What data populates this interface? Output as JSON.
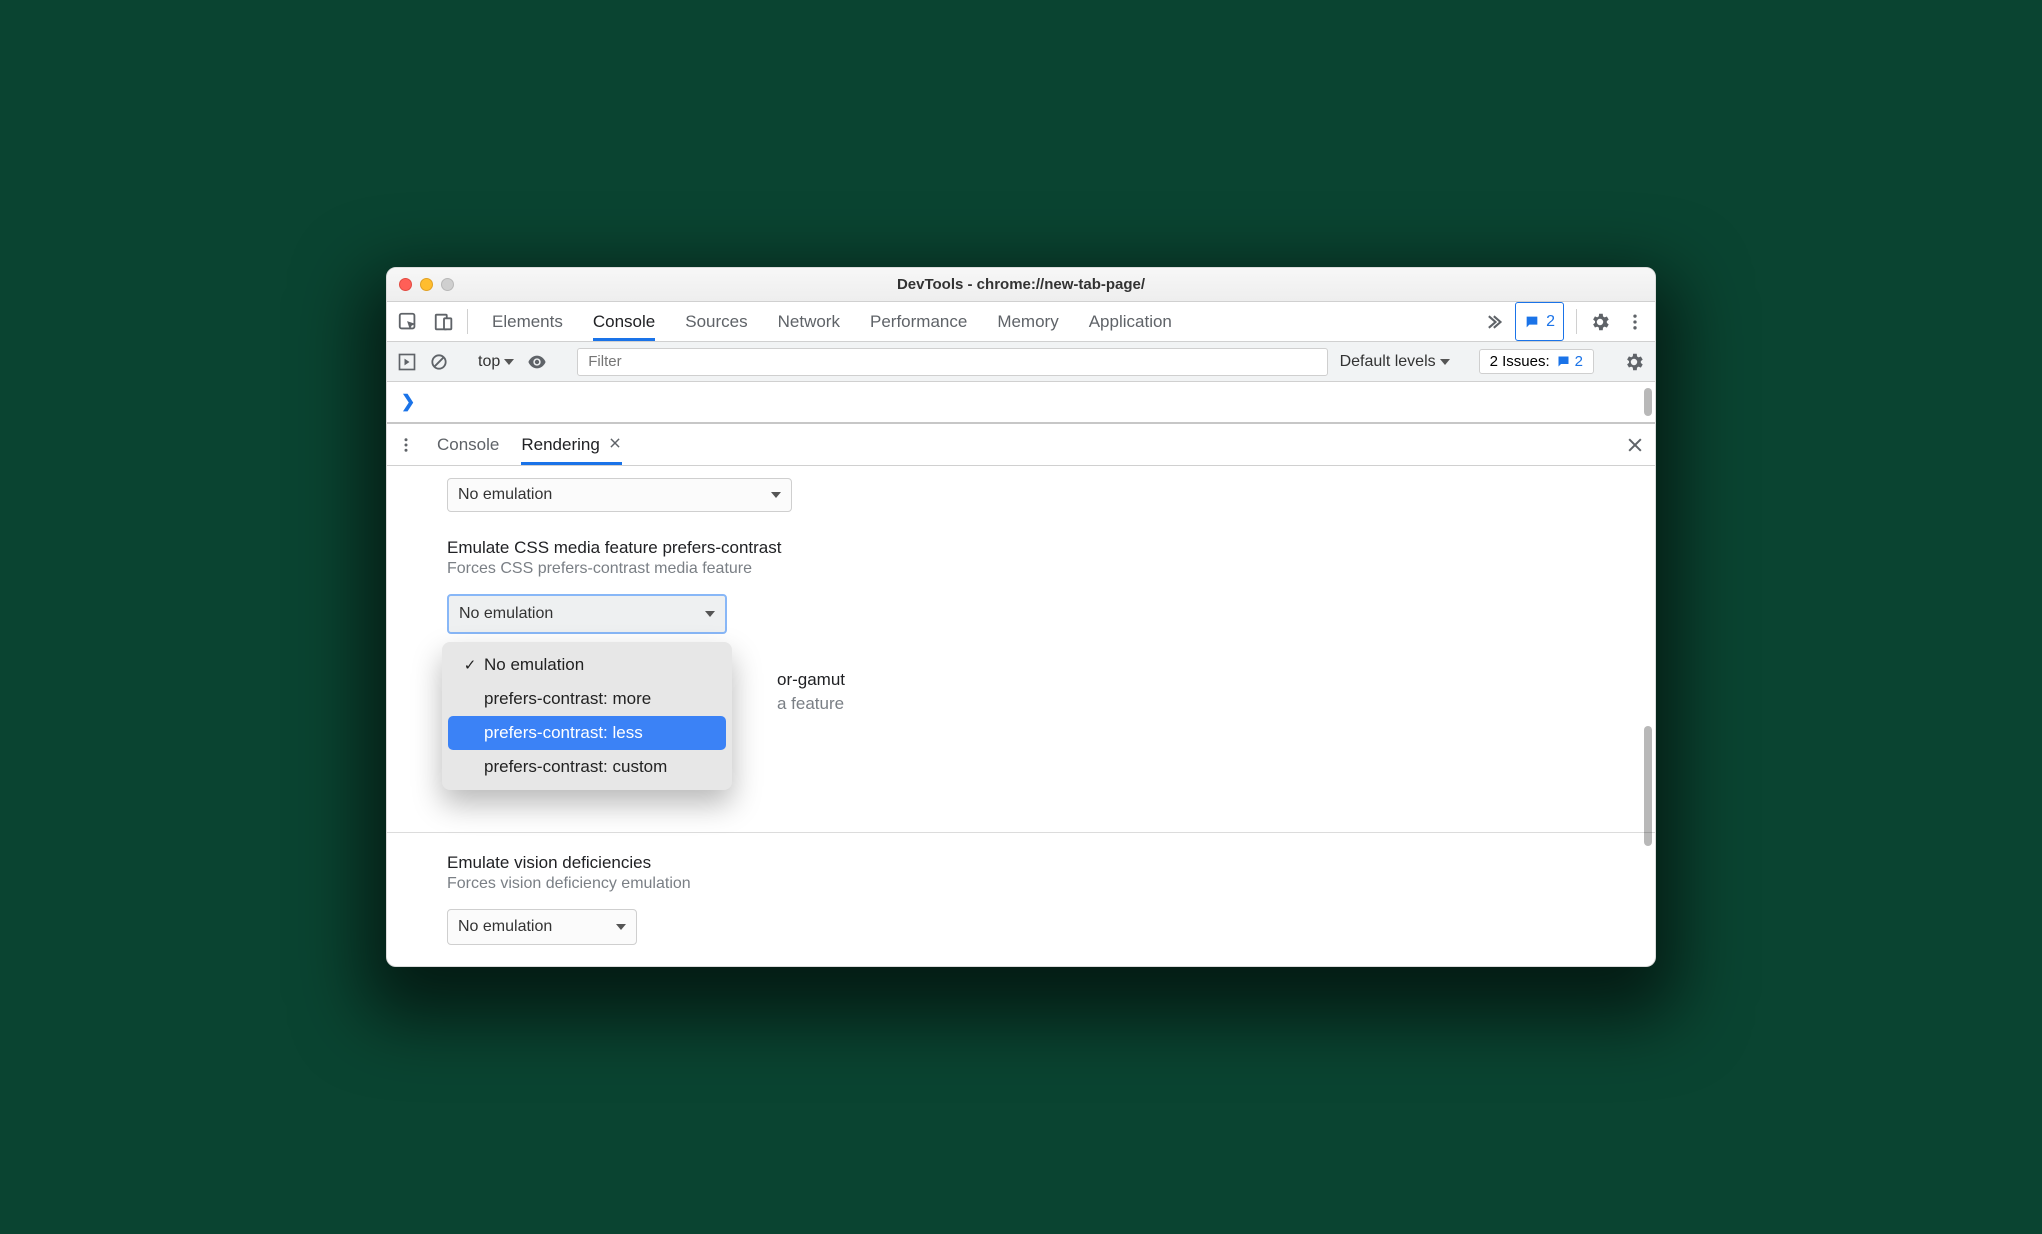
{
  "window": {
    "title": "DevTools - chrome://new-tab-page/"
  },
  "tabs": {
    "items": [
      "Elements",
      "Console",
      "Sources",
      "Network",
      "Performance",
      "Memory",
      "Application"
    ],
    "active": "Console"
  },
  "toolbar": {
    "issues_badge_count": "2"
  },
  "filterbar": {
    "context": "top",
    "filter_placeholder": "Filter",
    "levels": "Default levels",
    "issues_label": "2 Issues:",
    "issues_count": "2"
  },
  "drawer": {
    "tabs": [
      "Console",
      "Rendering"
    ],
    "active": "Rendering"
  },
  "rendering": {
    "top_select_value": "No emulation",
    "contrast": {
      "heading": "Emulate CSS media feature prefers-contrast",
      "hint": "Forces CSS prefers-contrast media feature",
      "select_value": "No emulation",
      "options": [
        "No emulation",
        "prefers-contrast: more",
        "prefers-contrast: less",
        "prefers-contrast: custom"
      ],
      "checked_index": 0,
      "highlight_index": 2
    },
    "gamut": {
      "heading_partial_right": "or-gamut",
      "hint_partial_right": "a feature"
    },
    "vision": {
      "heading": "Emulate vision deficiencies",
      "hint": "Forces vision deficiency emulation",
      "select_value": "No emulation"
    }
  }
}
